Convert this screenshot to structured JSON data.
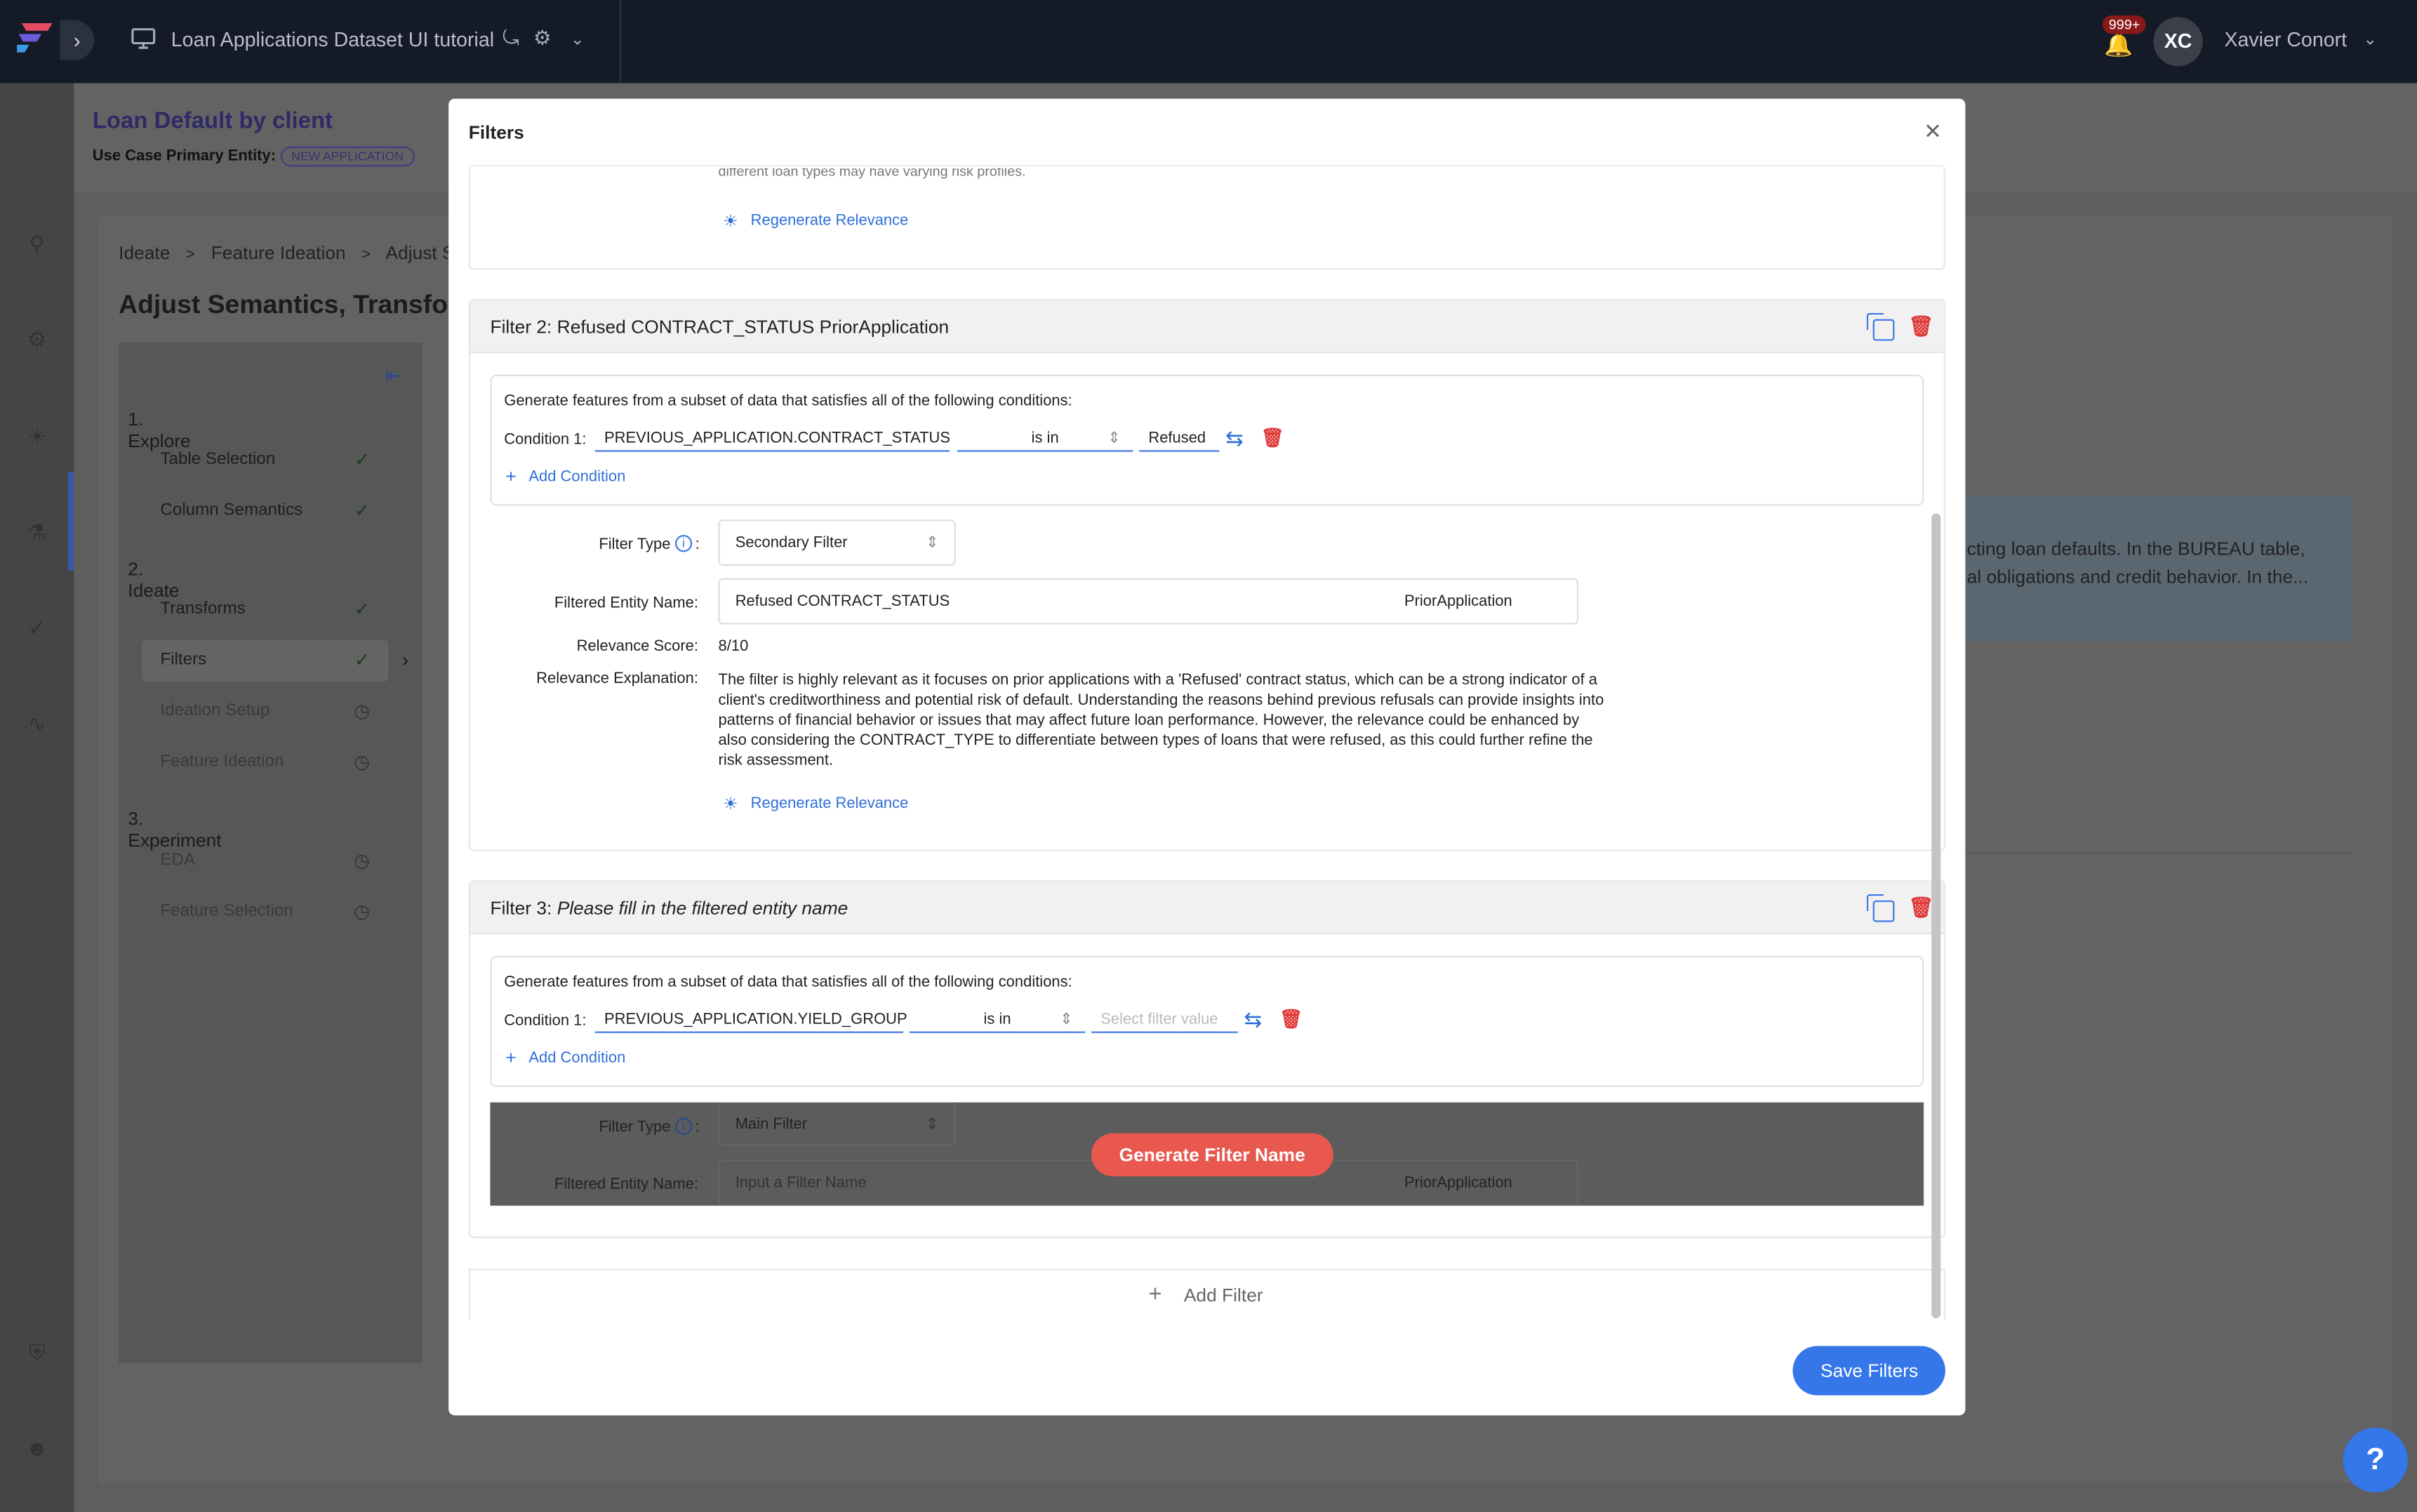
{
  "topbar": {
    "app_title": "Loan Applications Dataset UI tutorial",
    "notif_badge": "999+",
    "user_initials": "XC",
    "user_name": "Xavier Conort"
  },
  "header": {
    "project_title": "Loan Default by client",
    "primary_entity_label": "Use Case Primary Entity:",
    "primary_entity_badge": "NEW APPLICATION"
  },
  "breadcrumb": [
    "Ideate",
    ">",
    "Feature Ideation",
    ">",
    "Adjust S"
  ],
  "page_title": "Adjust Semantics, Transfor",
  "sidebar": {
    "sections": [
      {
        "label": "1. Explore",
        "items": [
          {
            "label": "Table Selection",
            "status": "check"
          },
          {
            "label": "Column Semantics",
            "status": "check"
          }
        ]
      },
      {
        "label": "2. Ideate",
        "items": [
          {
            "label": "Transforms",
            "status": "check"
          },
          {
            "label": "Filters",
            "status": "check"
          },
          {
            "label": "Ideation Setup",
            "status": "pending"
          },
          {
            "label": "Feature Ideation",
            "status": "pending"
          }
        ]
      },
      {
        "label": "3. Experiment",
        "items": [
          {
            "label": "EDA",
            "status": "pending"
          },
          {
            "label": "Feature Selection",
            "status": "pending"
          }
        ]
      }
    ]
  },
  "bg_text": {
    "line1": "cting loan defaults. In the BUREAU table,",
    "line2": "al obligations and credit behavior. In the..."
  },
  "modal": {
    "title": "Filters",
    "partial_text": "different loan types may have varying risk profiles.",
    "regenerate_label": "Regenerate Relevance",
    "filter2": {
      "title": "Filter 2: Refused CONTRACT_STATUS PriorApplication",
      "conditions_intro": "Generate features from a subset of data that satisfies all of the following conditions:",
      "condition_label": "Condition 1:",
      "condition_column": "PREVIOUS_APPLICATION.CONTRACT_STATUS",
      "condition_op": "is in",
      "condition_value": "Refused",
      "add_condition": "Add Condition",
      "filter_type_label": "Filter Type",
      "filter_type_value": "Secondary Filter",
      "entity_name_label": "Filtered Entity Name:",
      "entity_name_value": "Refused CONTRACT_STATUS",
      "entity_suffix": "PriorApplication",
      "score_label": "Relevance Score:",
      "score_value": "8/10",
      "explanation_label": "Relevance Explanation:",
      "explanation": "The filter is highly relevant as it focuses on prior applications with a 'Refused' contract status, which can be a strong indicator of a client's creditworthiness and potential risk of default. Understanding the reasons behind previous refusals can provide insights into patterns of financial behavior or issues that may affect future loan performance. However, the relevance could be enhanced by also considering the CONTRACT_TYPE to differentiate between types of loans that were refused, as this could further refine the risk assessment."
    },
    "filter3": {
      "title_prefix": "Filter 3:",
      "title_placeholder": "Please fill in the filtered entity name",
      "conditions_intro": "Generate features from a subset of data that satisfies all of the following conditions:",
      "condition_label": "Condition 1:",
      "condition_column": "PREVIOUS_APPLICATION.YIELD_GROUP",
      "condition_op": "is in",
      "condition_value_placeholder": "Select filter value",
      "add_condition": "Add Condition",
      "filter_type_label": "Filter Type",
      "filter_type_value": "Main Filter",
      "entity_name_label": "Filtered Entity Name:",
      "entity_name_placeholder": "Input a Filter Name",
      "entity_suffix": "PriorApplication",
      "generate_button": "Generate Filter Name"
    },
    "add_filter": "Add Filter",
    "save_button": "Save Filters"
  },
  "help_button": "?",
  "colors": {
    "accent": "#3576e8",
    "danger": "#e03b3b",
    "generate": "#e8584e",
    "topbar": "#141a26"
  }
}
